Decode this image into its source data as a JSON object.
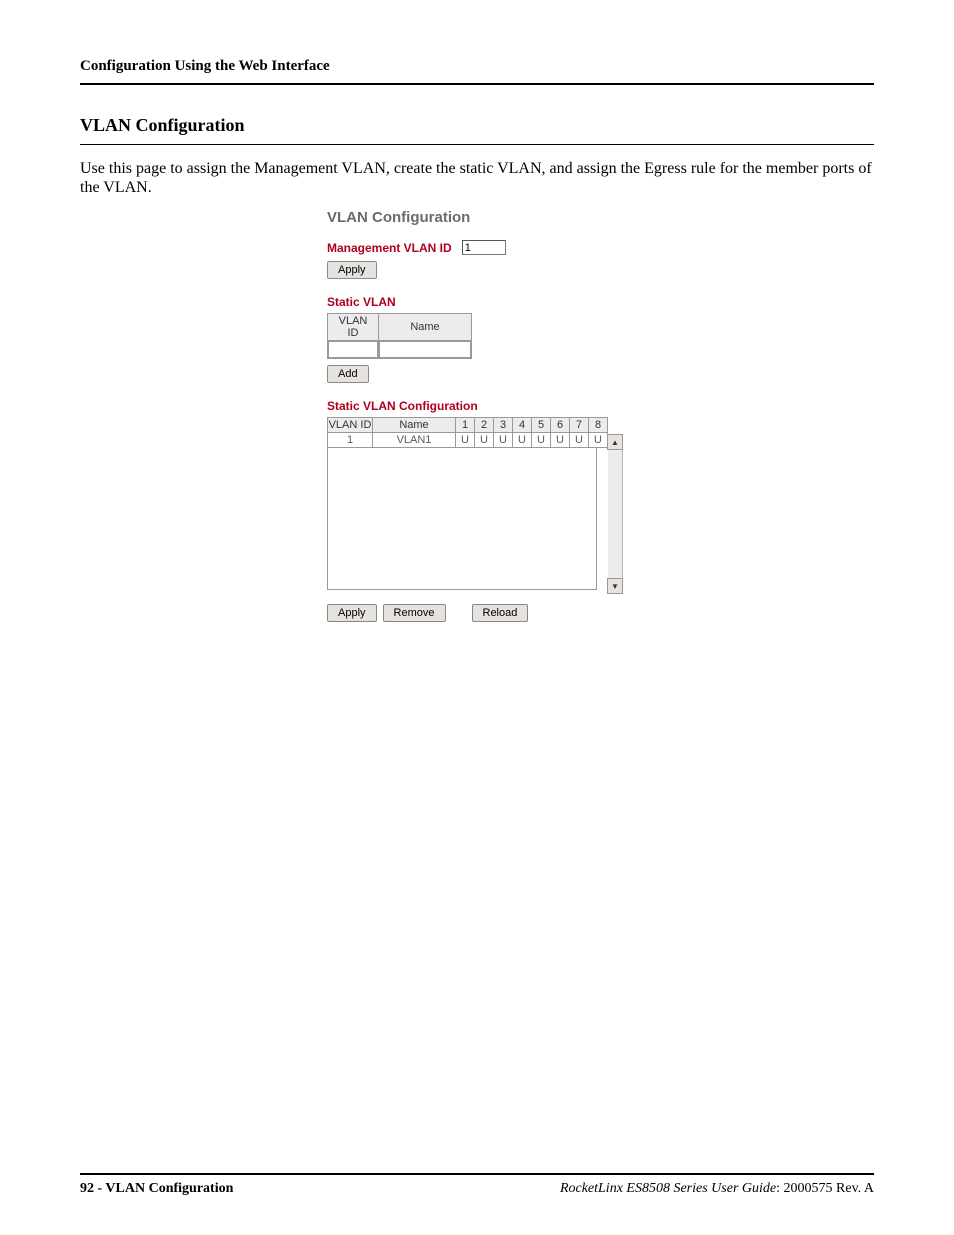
{
  "running_head": "Configuration Using the Web Interface",
  "section_title": "VLAN Configuration",
  "body_text": "Use this page to assign the Management VLAN, create the static VLAN, and assign the Egress rule for the member ports of the VLAN.",
  "ui": {
    "title": "VLAN Configuration",
    "mgmt_label": "Management VLAN ID",
    "mgmt_value": "1",
    "apply_label": "Apply",
    "static_vlan_label": "Static VLAN",
    "static_vlan_headers": {
      "id": "VLAN ID",
      "name": "Name"
    },
    "add_label": "Add",
    "svlan_config_label": "Static VLAN Configuration",
    "svlan_config_headers": {
      "id": "VLAN ID",
      "name": "Name",
      "ports": [
        "1",
        "2",
        "3",
        "4",
        "5",
        "6",
        "7",
        "8"
      ]
    },
    "svlan_rows": [
      {
        "id": "1",
        "name": "VLAN1",
        "ports": [
          "U",
          "U",
          "U",
          "U",
          "U",
          "U",
          "U",
          "U"
        ]
      }
    ],
    "action_buttons": {
      "apply": "Apply",
      "remove": "Remove",
      "reload": "Reload"
    }
  },
  "footer": {
    "page_num": "92",
    "page_title": "VLAN Configuration",
    "guide": "RocketLinx ES8508 Series  User Guide",
    "rev": ": 2000575 Rev. A"
  }
}
